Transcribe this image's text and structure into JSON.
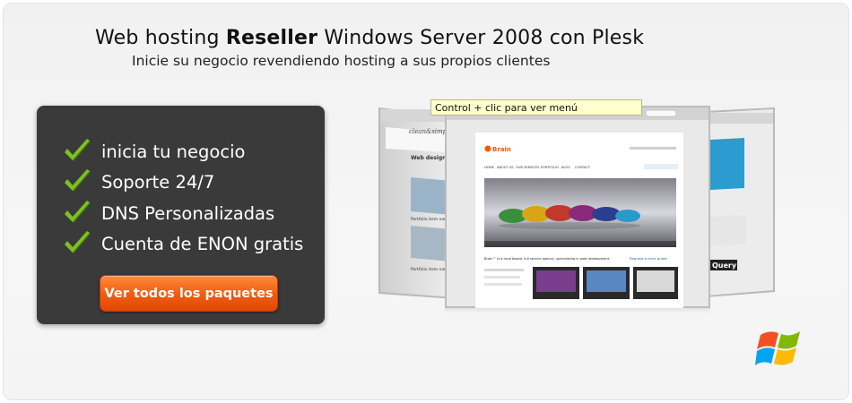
{
  "header": {
    "title_prefix": "Web hosting ",
    "title_bold": "Reseller",
    "title_suffix": " Windows Server 2008 con Plesk",
    "subtitle": "Inicie su negocio revendiendo hosting a sus propios clientes"
  },
  "features": {
    "items": [
      {
        "label": "inicia tu negocio"
      },
      {
        "label": "Soporte 24/7"
      },
      {
        "label": "DNS Personalizadas"
      },
      {
        "label": "Cuenta de ENON gratis"
      }
    ]
  },
  "cta": {
    "label": "Ver todos los paquetes"
  },
  "preview": {
    "tooltip": "Control + clic para ver menú",
    "center_site": {
      "logo": "Brain",
      "nav": [
        "HOME",
        "ABOUT US",
        "OUR SERVICES",
        "PORTFOLIO",
        "BLOG",
        "CONTACT"
      ],
      "tagline": "Brain™ is a local based, full service agency, specializing in web development.",
      "quote_link": "Request a price quote"
    },
    "left_site": {
      "logo": "clean&simple",
      "heading": "Web design and d",
      "item_a": "Portfolio item name",
      "item_b": "Portfolio item name"
    },
    "right_site": {
      "badge": "Query"
    }
  },
  "colors": {
    "accent": "#f05a10",
    "panel": "#3a3a3a",
    "check": "#6aa617"
  },
  "icons": {
    "check": "check-icon",
    "windows": "windows-logo-icon"
  }
}
